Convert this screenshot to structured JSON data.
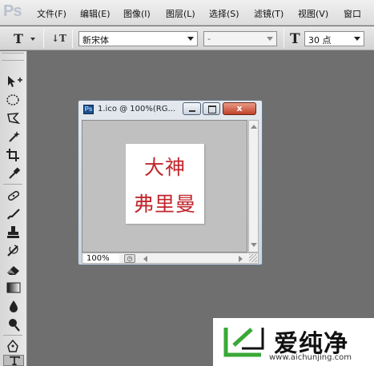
{
  "app": {
    "logo_text": "Ps"
  },
  "menu": {
    "items": [
      "文件(F)",
      "编辑(E)",
      "图像(I)",
      "图层(L)",
      "选择(S)",
      "滤镜(T)",
      "视图(V)",
      "窗口"
    ]
  },
  "options": {
    "tool_glyph": "T",
    "orient_glyph": "↓T",
    "font_family": "新宋体",
    "font_style": "-",
    "size_glyph": "T",
    "font_size": "30 点"
  },
  "document": {
    "title": "1.ico @ 100%(RG...",
    "ps_icon": "Ps",
    "close_glyph": "x",
    "zoom": "100%",
    "lines": [
      "大神",
      "弗里曼"
    ]
  },
  "watermark": {
    "title": "爱纯净",
    "url": "www.aichunjing.com",
    "colors": {
      "green": "#39a936"
    }
  },
  "toolbox": {
    "tools": [
      "move-tool-icon",
      "marquee-tool-icon",
      "lasso-tool-icon",
      "magic-wand-icon",
      "crop-tool-icon",
      "eyedropper-icon",
      "healing-brush-icon",
      "brush-tool-icon",
      "clone-stamp-icon",
      "history-brush-icon",
      "eraser-icon",
      "gradient-tool-icon",
      "blur-tool-icon",
      "dodge-tool-icon",
      "pen-tool-icon",
      "type-tool-icon"
    ]
  }
}
